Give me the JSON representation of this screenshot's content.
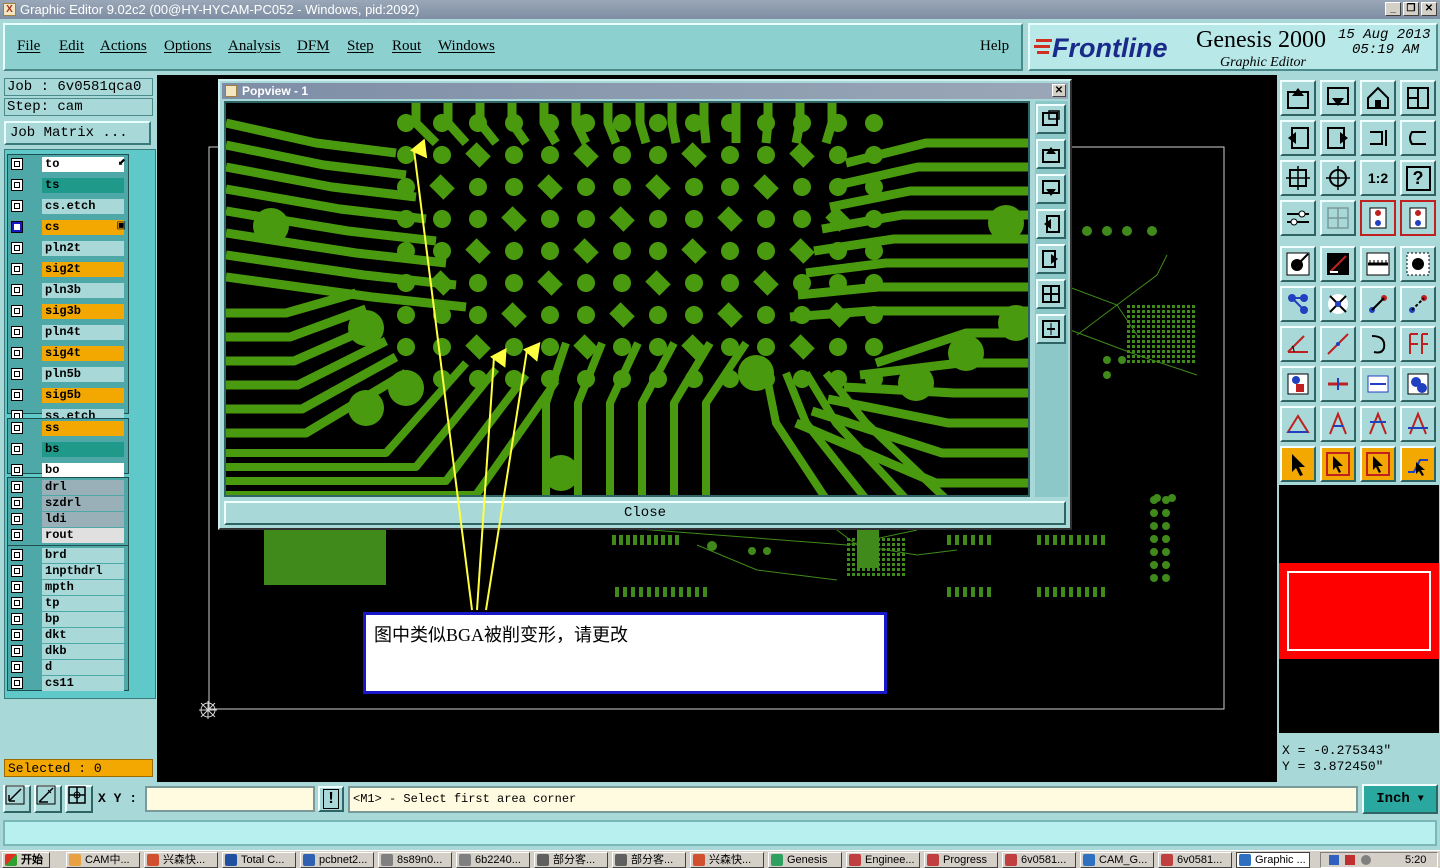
{
  "window": {
    "title": "Graphic Editor 9.02c2 (00@HY-HYCAM-PC052 - Windows, pid:2092)",
    "min_label": "_",
    "max_label": "❐",
    "close_label": "✕"
  },
  "menu": {
    "items": [
      "File",
      "Edit",
      "Actions",
      "Options",
      "Analysis",
      "DFM",
      "Step",
      "Rout",
      "Windows"
    ],
    "help": "Help"
  },
  "brand": {
    "logo": "Frontline",
    "product": "Genesis 2000",
    "subtitle": "Graphic Editor",
    "date": "15 Aug 2013",
    "time": "05:19 AM"
  },
  "job": {
    "job_label": "Job : 6v0581qca0",
    "step_label": "Step: cam",
    "matrix_button": "Job Matrix ..."
  },
  "layers": {
    "group1": [
      {
        "name": "to",
        "color": "#ffffff",
        "active": false,
        "marker": "⬋"
      },
      {
        "name": "ts",
        "color": "#1f9a8a"
      },
      {
        "name": "cs.etch",
        "color": "#a8d8d8"
      },
      {
        "name": "cs",
        "color": "#f2a800",
        "active": true,
        "marker": "▣"
      },
      {
        "name": "pln2t",
        "color": "#a8d8d8"
      },
      {
        "name": "sig2t",
        "color": "#f2a800"
      },
      {
        "name": "pln3b",
        "color": "#a8d8d8"
      },
      {
        "name": "sig3b",
        "color": "#f2a800"
      },
      {
        "name": "pln4t",
        "color": "#a8d8d8"
      },
      {
        "name": "sig4t",
        "color": "#f2a800"
      },
      {
        "name": "pln5b",
        "color": "#a8d8d8"
      },
      {
        "name": "sig5b",
        "color": "#f2a800"
      },
      {
        "name": "ss.etch",
        "color": "#a8d8d8"
      }
    ],
    "group2": [
      {
        "name": "ss",
        "color": "#f2a800"
      },
      {
        "name": "bs",
        "color": "#1f9a8a"
      },
      {
        "name": "bo",
        "color": "#ffffff"
      }
    ],
    "group3": [
      {
        "name": "drl",
        "color": "#9ab0b8"
      },
      {
        "name": "szdrl",
        "color": "#9ab0b8"
      },
      {
        "name": "ldi",
        "color": "#9ab0b8"
      },
      {
        "name": "rout",
        "color": "#e0e0e0"
      }
    ],
    "group4": [
      {
        "name": "brd",
        "color": "#a8d8d8"
      },
      {
        "name": "1npthdrl",
        "color": "#a8d8d8"
      },
      {
        "name": "mpth",
        "color": "#a8d8d8"
      },
      {
        "name": "tp",
        "color": "#a8d8d8"
      },
      {
        "name": "bp",
        "color": "#a8d8d8"
      },
      {
        "name": "dkt",
        "color": "#a8d8d8"
      },
      {
        "name": "dkb",
        "color": "#a8d8d8"
      },
      {
        "name": "d",
        "color": "#a8d8d8"
      },
      {
        "name": "cs11",
        "color": "#a8d8d8"
      }
    ]
  },
  "selected": "Selected : 0",
  "popview": {
    "title": "Popview - 1",
    "close": "Close"
  },
  "callout": {
    "text": "图中类似BGA被削变形，请更改"
  },
  "coords": {
    "x": "X = -0.275343\"",
    "y": "Y = 3.872450\""
  },
  "toolbar": {
    "ratio_label": "1:2",
    "help_label": "?"
  },
  "command": {
    "xy_label": "X Y :",
    "xy_value": "",
    "prompt": "<M1> - Select first area corner",
    "units": "Inch",
    "alert": "!"
  },
  "taskbar": {
    "start": "开始",
    "tasks": [
      "CAM中...",
      "兴森快...",
      "Total C...",
      "pcbnet2...",
      "8s89n0...",
      "6b2240...",
      "部分客...",
      "部分客...",
      "兴森快...",
      "Genesis",
      "Enginee...",
      "Progress",
      "6v0581...",
      "CAM_G...",
      "6v0581...",
      "Graphic ..."
    ],
    "clock": "5:20"
  },
  "colors": {
    "panel": "#a8d8d8",
    "copper": "#4a9a10",
    "accent": "#f2a800",
    "callout_border": "#1818c8"
  }
}
